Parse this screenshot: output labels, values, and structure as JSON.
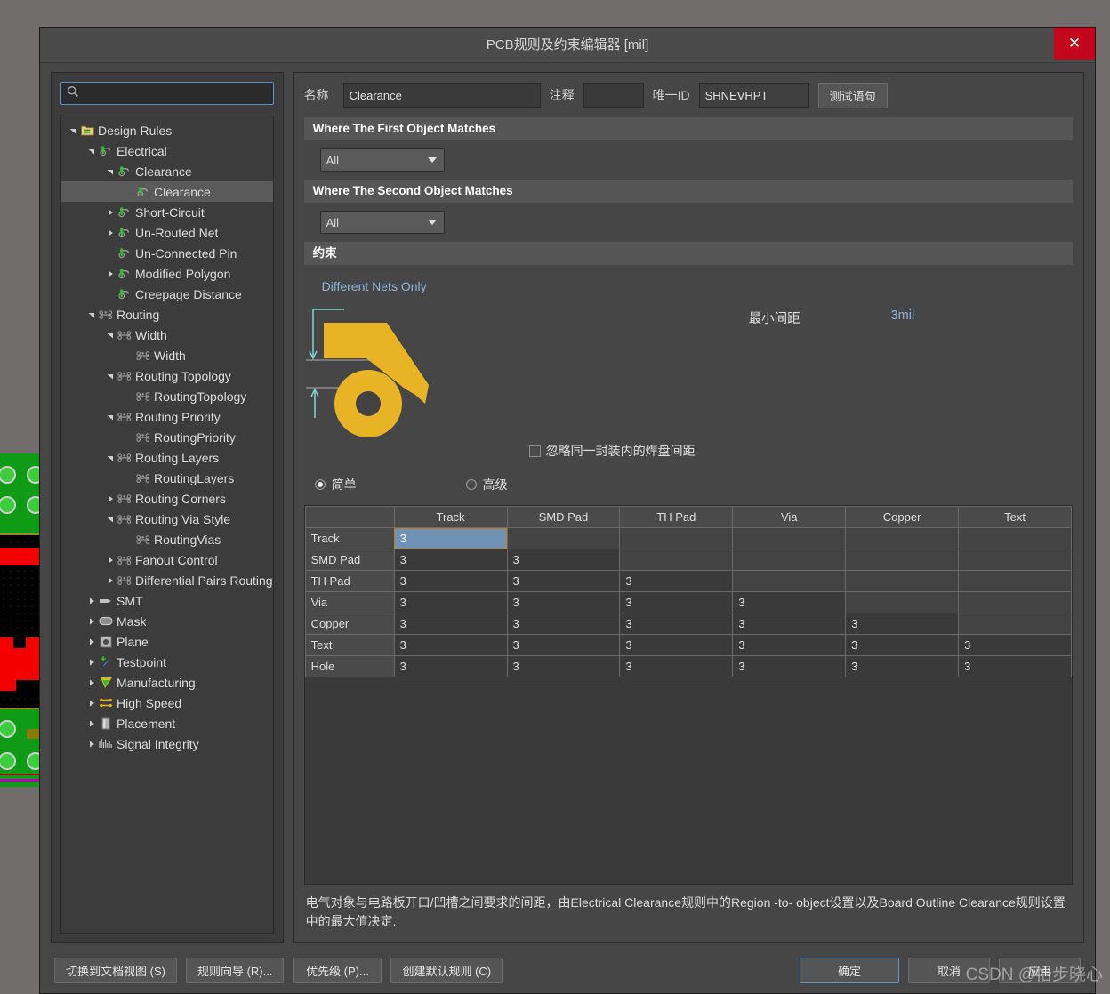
{
  "window": {
    "title": "PCB规则及约束编辑器 [mil]",
    "close_label": "✕"
  },
  "search": {
    "value": "",
    "placeholder": ""
  },
  "tree": {
    "items": [
      {
        "label": "Design Rules",
        "depth": 0,
        "arrow": "down",
        "icon": "folder-icon",
        "selected": false
      },
      {
        "label": "Electrical",
        "depth": 1,
        "arrow": "down",
        "icon": "electrical-icon",
        "selected": false
      },
      {
        "label": "Clearance",
        "depth": 2,
        "arrow": "down",
        "icon": "electrical-icon",
        "selected": false
      },
      {
        "label": "Clearance",
        "depth": 3,
        "arrow": "none",
        "icon": "electrical-icon",
        "selected": true
      },
      {
        "label": "Short-Circuit",
        "depth": 2,
        "arrow": "right",
        "icon": "electrical-icon",
        "selected": false
      },
      {
        "label": "Un-Routed Net",
        "depth": 2,
        "arrow": "right",
        "icon": "electrical-icon",
        "selected": false
      },
      {
        "label": "Un-Connected Pin",
        "depth": 2,
        "arrow": "none",
        "icon": "electrical-icon",
        "selected": false
      },
      {
        "label": "Modified Polygon",
        "depth": 2,
        "arrow": "right",
        "icon": "electrical-icon",
        "selected": false
      },
      {
        "label": "Creepage Distance",
        "depth": 2,
        "arrow": "none",
        "icon": "electrical-icon",
        "selected": false
      },
      {
        "label": "Routing",
        "depth": 1,
        "arrow": "down",
        "icon": "routing-icon",
        "selected": false
      },
      {
        "label": "Width",
        "depth": 2,
        "arrow": "down",
        "icon": "routing-icon",
        "selected": false
      },
      {
        "label": "Width",
        "depth": 3,
        "arrow": "none",
        "icon": "routing-icon",
        "selected": false
      },
      {
        "label": "Routing Topology",
        "depth": 2,
        "arrow": "down",
        "icon": "routing-icon",
        "selected": false
      },
      {
        "label": "RoutingTopology",
        "depth": 3,
        "arrow": "none",
        "icon": "routing-icon",
        "selected": false
      },
      {
        "label": "Routing Priority",
        "depth": 2,
        "arrow": "down",
        "icon": "routing-icon",
        "selected": false
      },
      {
        "label": "RoutingPriority",
        "depth": 3,
        "arrow": "none",
        "icon": "routing-icon",
        "selected": false
      },
      {
        "label": "Routing Layers",
        "depth": 2,
        "arrow": "down",
        "icon": "routing-icon",
        "selected": false
      },
      {
        "label": "RoutingLayers",
        "depth": 3,
        "arrow": "none",
        "icon": "routing-icon",
        "selected": false
      },
      {
        "label": "Routing Corners",
        "depth": 2,
        "arrow": "right",
        "icon": "routing-icon",
        "selected": false
      },
      {
        "label": "Routing Via Style",
        "depth": 2,
        "arrow": "down",
        "icon": "routing-icon",
        "selected": false
      },
      {
        "label": "RoutingVias",
        "depth": 3,
        "arrow": "none",
        "icon": "routing-icon",
        "selected": false
      },
      {
        "label": "Fanout Control",
        "depth": 2,
        "arrow": "right",
        "icon": "routing-icon",
        "selected": false
      },
      {
        "label": "Differential Pairs Routing",
        "depth": 2,
        "arrow": "right",
        "icon": "routing-icon",
        "selected": false
      },
      {
        "label": "SMT",
        "depth": 1,
        "arrow": "right",
        "icon": "smt-icon",
        "selected": false
      },
      {
        "label": "Mask",
        "depth": 1,
        "arrow": "right",
        "icon": "mask-icon",
        "selected": false
      },
      {
        "label": "Plane",
        "depth": 1,
        "arrow": "right",
        "icon": "plane-icon",
        "selected": false
      },
      {
        "label": "Testpoint",
        "depth": 1,
        "arrow": "right",
        "icon": "testpoint-icon",
        "selected": false
      },
      {
        "label": "Manufacturing",
        "depth": 1,
        "arrow": "right",
        "icon": "manufacturing-icon",
        "selected": false
      },
      {
        "label": "High Speed",
        "depth": 1,
        "arrow": "right",
        "icon": "highspeed-icon",
        "selected": false
      },
      {
        "label": "Placement",
        "depth": 1,
        "arrow": "right",
        "icon": "placement-icon",
        "selected": false
      },
      {
        "label": "Signal Integrity",
        "depth": 1,
        "arrow": "right",
        "icon": "signal-icon",
        "selected": false
      }
    ]
  },
  "meta": {
    "name_label": "名称",
    "name_value": "Clearance",
    "comment_label": "注释",
    "comment_value": "",
    "uid_label": "唯一ID",
    "uid_value": "SHNEVHPT",
    "test_button": "测试语句"
  },
  "first_object": {
    "heading": "Where The First Object Matches",
    "scope_value": "All"
  },
  "second_object": {
    "heading": "Where The Second Object Matches",
    "scope_value": "All"
  },
  "constraint": {
    "heading": "约束",
    "different_nets_only": "Different Nets Only",
    "min_gap_label": "最小间距",
    "min_gap_value": "3mil",
    "ignore_pad_label": "忽略同一封装内的焊盘间距",
    "ignore_pad_checked": false,
    "mode_simple": "简单",
    "mode_advanced": "高级",
    "mode_selected": "简单"
  },
  "matrix": {
    "columns": [
      "",
      "Track",
      "SMD Pad",
      "TH Pad",
      "Via",
      "Copper",
      "Text"
    ],
    "rows": [
      {
        "label": "Track",
        "values": [
          "3",
          "",
          "",
          "",
          "",
          ""
        ]
      },
      {
        "label": "SMD Pad",
        "values": [
          "3",
          "3",
          "",
          "",
          "",
          ""
        ]
      },
      {
        "label": "TH Pad",
        "values": [
          "3",
          "3",
          "3",
          "",
          "",
          ""
        ]
      },
      {
        "label": "Via",
        "values": [
          "3",
          "3",
          "3",
          "3",
          "",
          ""
        ]
      },
      {
        "label": "Copper",
        "values": [
          "3",
          "3",
          "3",
          "3",
          "3",
          ""
        ]
      },
      {
        "label": "Text",
        "values": [
          "3",
          "3",
          "3",
          "3",
          "3",
          "3"
        ]
      },
      {
        "label": "Hole",
        "values": [
          "3",
          "3",
          "3",
          "3",
          "3",
          "3"
        ]
      }
    ],
    "selected_cell": {
      "row": 0,
      "col": 0
    }
  },
  "description": "电气对象与电路板开口/凹槽之间要求的间距，由Electrical Clearance规则中的Region -to- object设置以及Board Outline Clearance规则设置中的最大值决定.",
  "footer": {
    "switch_doc_view": "切换到文档视图 (S)",
    "rule_wizard": "规则向导 (R)...",
    "priority": "优先级 (P)...",
    "create_default": "创建默认规则 (C)",
    "ok": "确定",
    "cancel": "取消",
    "apply": "应用"
  },
  "watermark": "CSDN @怡步晓心",
  "colors": {
    "accent_blue": "#8ab4dc",
    "trace_yellow": "#e8b325",
    "selection_blue": "#6f92b5",
    "close_red": "#c4061c"
  }
}
